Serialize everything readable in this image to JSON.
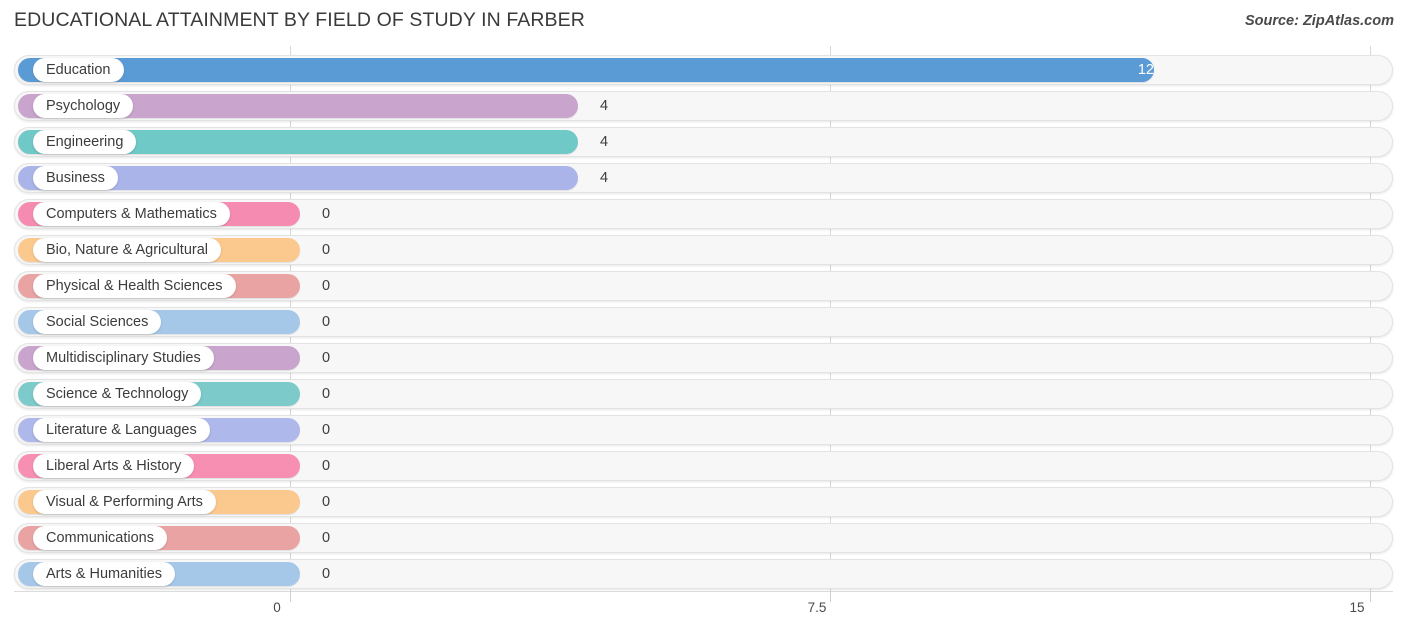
{
  "header": {
    "title": "EDUCATIONAL ATTAINMENT BY FIELD OF STUDY IN FARBER",
    "source": "Source: ZipAtlas.com"
  },
  "chart_data": {
    "type": "bar",
    "orientation": "horizontal",
    "title": "EDUCATIONAL ATTAINMENT BY FIELD OF STUDY IN FARBER",
    "xlabel": "",
    "ylabel": "",
    "xlim": [
      0,
      15
    ],
    "ticks": [
      "0",
      "7.5",
      "15"
    ],
    "tick_values": [
      0,
      7.5,
      15
    ],
    "grid": true,
    "legend": "none",
    "categories": [
      "Education",
      "Psychology",
      "Engineering",
      "Business",
      "Computers & Mathematics",
      "Bio, Nature & Agricultural",
      "Physical & Health Sciences",
      "Social Sciences",
      "Multidisciplinary Studies",
      "Science & Technology",
      "Literature & Languages",
      "Liberal Arts & History",
      "Visual & Performing Arts",
      "Communications",
      "Arts & Humanities"
    ],
    "values": [
      12,
      4,
      4,
      4,
      0,
      0,
      0,
      0,
      0,
      0,
      0,
      0,
      0,
      0,
      0
    ],
    "value_labels": [
      "12",
      "4",
      "4",
      "4",
      "0",
      "0",
      "0",
      "0",
      "0",
      "0",
      "0",
      "0",
      "0",
      "0",
      "0"
    ],
    "colors": [
      "#5b9bd5",
      "#c9a4cd",
      "#6fc9c6",
      "#aab4e8",
      "#f58bb0",
      "#fbc98d",
      "#e9a3a3",
      "#a6c8e8",
      "#c9a4cd",
      "#7ccac9",
      "#aeb8ea",
      "#f78fb3",
      "#fbc98d",
      "#e9a3a3",
      "#a6c8e8"
    ]
  },
  "rows": [
    {
      "label": "Education",
      "value_label": "12",
      "value": 12,
      "color": "#5b9bd5",
      "inside": true
    },
    {
      "label": "Psychology",
      "value_label": "4",
      "value": 4,
      "color": "#c9a4cd",
      "inside": false
    },
    {
      "label": "Engineering",
      "value_label": "4",
      "value": 4,
      "color": "#6fc9c6",
      "inside": false
    },
    {
      "label": "Business",
      "value_label": "4",
      "value": 4,
      "color": "#aab4e8",
      "inside": false
    },
    {
      "label": "Computers & Mathematics",
      "value_label": "0",
      "value": 0,
      "color": "#f58bb0",
      "inside": false
    },
    {
      "label": "Bio, Nature & Agricultural",
      "value_label": "0",
      "value": 0,
      "color": "#fbc98d",
      "inside": false
    },
    {
      "label": "Physical & Health Sciences",
      "value_label": "0",
      "value": 0,
      "color": "#e9a3a3",
      "inside": false
    },
    {
      "label": "Social Sciences",
      "value_label": "0",
      "value": 0,
      "color": "#a6c8e8",
      "inside": false
    },
    {
      "label": "Multidisciplinary Studies",
      "value_label": "0",
      "value": 0,
      "color": "#c9a4cd",
      "inside": false
    },
    {
      "label": "Science & Technology",
      "value_label": "0",
      "value": 0,
      "color": "#7ccac9",
      "inside": false
    },
    {
      "label": "Literature & Languages",
      "value_label": "0",
      "value": 0,
      "color": "#aeb8ea",
      "inside": false
    },
    {
      "label": "Liberal Arts & History",
      "value_label": "0",
      "value": 0,
      "color": "#f78fb3",
      "inside": false
    },
    {
      "label": "Visual & Performing Arts",
      "value_label": "0",
      "value": 0,
      "color": "#fbc98d",
      "inside": false
    },
    {
      "label": "Communications",
      "value_label": "0",
      "value": 0,
      "color": "#e9a3a3",
      "inside": false
    },
    {
      "label": "Arts & Humanities",
      "value_label": "0",
      "value": 0,
      "color": "#a6c8e8",
      "inside": false
    }
  ],
  "axis": {
    "ticks": [
      {
        "label": "0",
        "value": 0
      },
      {
        "label": "7.5",
        "value": 7.5
      },
      {
        "label": "15",
        "value": 15
      }
    ]
  }
}
